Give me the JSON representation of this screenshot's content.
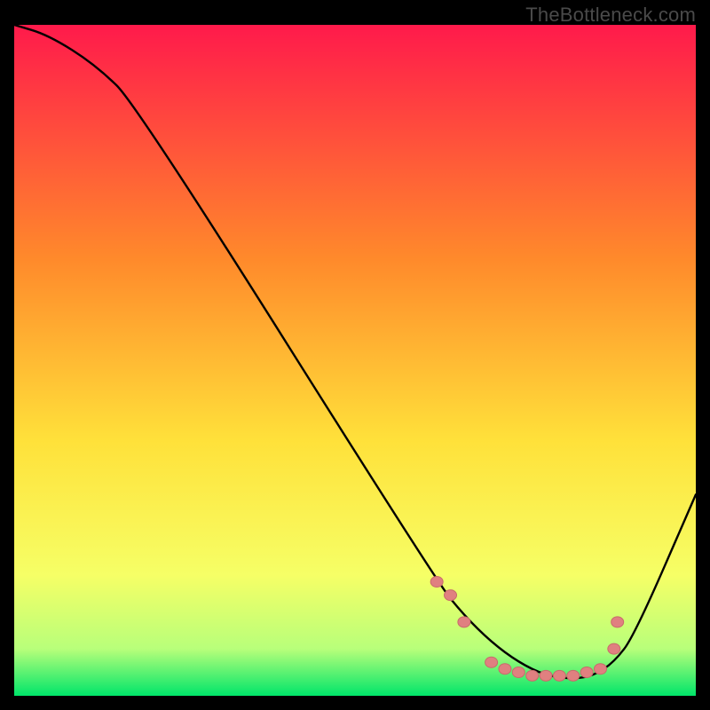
{
  "watermark": "TheBottleneck.com",
  "colors": {
    "gradient_top": "#ff1a4b",
    "gradient_upper_mid": "#ff8a2b",
    "gradient_mid": "#ffe13a",
    "gradient_lower_mid": "#f6ff66",
    "gradient_near_bottom": "#b8ff7a",
    "gradient_bottom": "#00e56a",
    "curve": "#000000",
    "marker_fill": "#e08080",
    "marker_stroke": "#c86b6b",
    "background": "#000000"
  },
  "chart_data": {
    "type": "line",
    "title": "",
    "xlabel": "",
    "ylabel": "",
    "xlim": [
      0,
      100
    ],
    "ylim": [
      0,
      100
    ],
    "series": [
      {
        "name": "bottleneck-curve",
        "x": [
          0,
          5,
          12,
          18,
          62,
          66,
          70,
          74,
          78,
          82,
          85,
          88,
          91,
          100
        ],
        "y": [
          100,
          98.5,
          94,
          88,
          17,
          12,
          8,
          5,
          3,
          2.5,
          3,
          5,
          9,
          30
        ]
      }
    ],
    "markers": [
      {
        "x": 62,
        "y": 17
      },
      {
        "x": 64,
        "y": 15
      },
      {
        "x": 66,
        "y": 11
      },
      {
        "x": 70,
        "y": 5
      },
      {
        "x": 72,
        "y": 4
      },
      {
        "x": 74,
        "y": 3.5
      },
      {
        "x": 76,
        "y": 3
      },
      {
        "x": 78,
        "y": 3
      },
      {
        "x": 80,
        "y": 3
      },
      {
        "x": 82,
        "y": 3
      },
      {
        "x": 84,
        "y": 3.5
      },
      {
        "x": 86,
        "y": 4
      },
      {
        "x": 88,
        "y": 7
      },
      {
        "x": 88.5,
        "y": 11
      }
    ]
  }
}
